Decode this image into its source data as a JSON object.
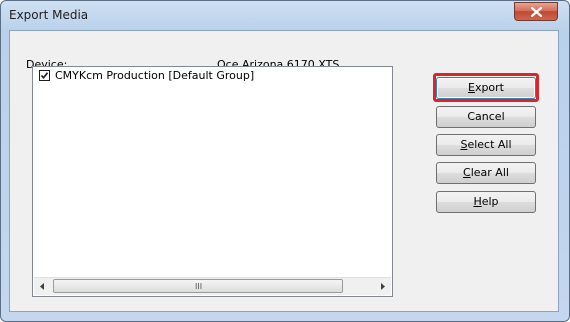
{
  "window": {
    "title": "Export Media"
  },
  "device": {
    "label": "Device:",
    "value": "Oce Arizona 6170 XTS"
  },
  "list": {
    "items": [
      {
        "label": "CMYKcm Production [Default Group]",
        "checked": true
      }
    ],
    "scroll_grip": "III"
  },
  "buttons": {
    "export": {
      "mnemonic": "E",
      "rest": "xport"
    },
    "cancel": {
      "label": "Cancel"
    },
    "select_all": {
      "mnemonic": "S",
      "rest": "elect All"
    },
    "clear_all": {
      "mnemonic": "C",
      "rest": "lear All"
    },
    "help": {
      "mnemonic": "H",
      "rest": "elp"
    }
  },
  "colors": {
    "highlight": "#d9262d",
    "close_button": "#c04a35",
    "frame": "#b9d1ea"
  }
}
